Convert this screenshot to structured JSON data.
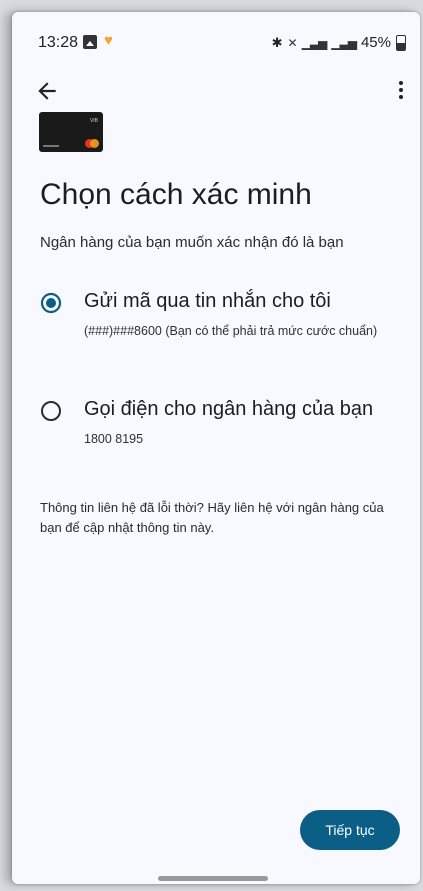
{
  "status_bar": {
    "time": "13:28",
    "battery": "45%",
    "network_text": "📶"
  },
  "header": {
    "back_icon": "arrow-left-icon",
    "more_icon": "more-vert-icon"
  },
  "card": {
    "brand_text": "VIB"
  },
  "main": {
    "title": "Chọn cách xác minh",
    "subtitle": "Ngân hàng của bạn muốn xác nhận đó là bạn",
    "options": [
      {
        "label": "Gửi mã qua tin nhắn cho tôi",
        "detail": "(###)###8600 (Bạn có thể phải trả mức cước chuẩn)",
        "selected": true
      },
      {
        "label": "Gọi điện cho ngân hàng của bạn",
        "detail": "1800 8195",
        "selected": false
      }
    ],
    "info": "Thông tin liên hệ đã lỗi thời? Hãy liên hệ với ngân hàng của bạn để cập nhật thông tin này."
  },
  "footer": {
    "continue_label": "Tiếp tục"
  },
  "colors": {
    "accent": "#0b5f86",
    "background": "#f8f8ff"
  }
}
